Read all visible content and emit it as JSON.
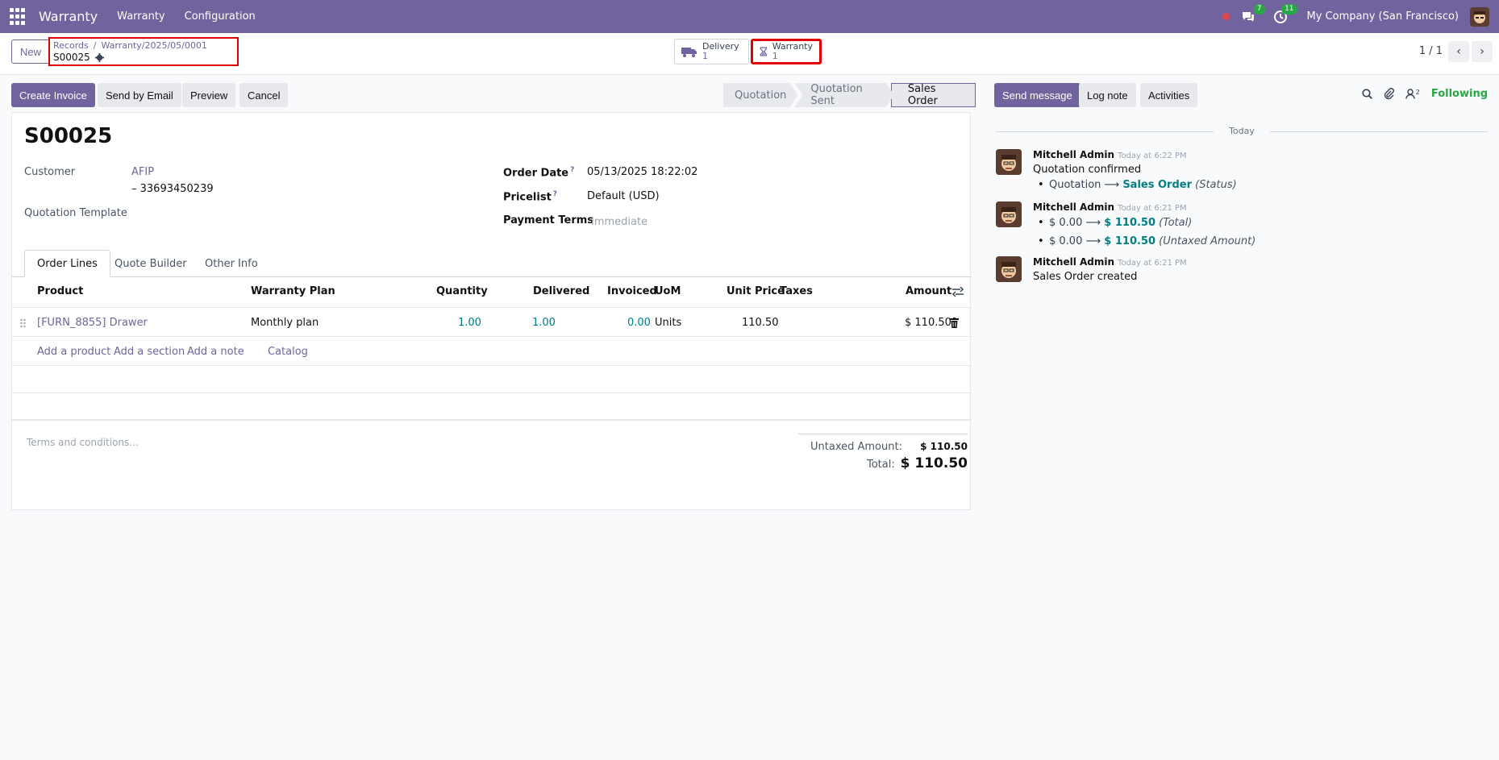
{
  "topbar": {
    "app_name": "Warranty",
    "menu": [
      "Warranty",
      "Configuration"
    ],
    "messages_count": "7",
    "activities_count": "11",
    "company": "My Company (San Francisco)"
  },
  "control": {
    "new_label": "New",
    "breadcrumb": [
      "Records",
      "Warranty/2025/05/0001"
    ],
    "current_record": "S00025",
    "smart_buttons": [
      {
        "label": "Delivery",
        "value": "1",
        "icon": "truck-icon"
      },
      {
        "label": "Warranty",
        "value": "1",
        "icon": "hourglass-icon"
      }
    ],
    "pager": "1 / 1"
  },
  "actions": {
    "create_invoice": "Create Invoice",
    "send_by_email": "Send by Email",
    "preview": "Preview",
    "cancel": "Cancel"
  },
  "statusbar": [
    "Quotation",
    "Quotation Sent",
    "Sales Order"
  ],
  "form": {
    "title": "S00025",
    "customer_label": "Customer",
    "customer_value": "AFIP",
    "customer_sub": "– 33693450239",
    "quotation_template_label": "Quotation Template",
    "order_date_label": "Order Date",
    "order_date_value": "05/13/2025 18:22:02",
    "pricelist_label": "Pricelist",
    "pricelist_value": "Default (USD)",
    "payment_terms_label": "Payment Terms",
    "payment_terms_placeholder": "Immediate",
    "help_mark": "?"
  },
  "tabs": [
    "Order Lines",
    "Quote Builder",
    "Other Info"
  ],
  "table": {
    "headers": [
      "Product",
      "Warranty Plan",
      "Quantity",
      "Delivered",
      "Invoiced",
      "UoM",
      "Unit Price",
      "Taxes",
      "Amount"
    ],
    "rows": [
      {
        "product": "[FURN_8855] Drawer",
        "warranty_plan": "Monthly plan",
        "quantity": "1.00",
        "delivered": "1.00",
        "invoiced": "0.00",
        "uom": "Units",
        "unit_price": "110.50",
        "taxes": "",
        "amount": "$ 110.50"
      }
    ],
    "add_links": [
      "Add a product",
      "Add a section",
      "Add a note",
      "Catalog"
    ]
  },
  "terms_placeholder": "Terms and conditions...",
  "totals": {
    "untaxed_label": "Untaxed Amount:",
    "untaxed_value": "$ 110.50",
    "total_label": "Total:",
    "total_value": "$ 110.50"
  },
  "chatter": {
    "send_message": "Send message",
    "log_note": "Log note",
    "activities": "Activities",
    "followers_count": "2",
    "following": "Following",
    "date_separator": "Today",
    "messages": [
      {
        "author": "Mitchell Admin",
        "time": "Today at 6:22 PM",
        "body": "Quotation confirmed",
        "tracking": [
          {
            "old": "Quotation",
            "new": "Sales Order",
            "field": "(Status)"
          }
        ]
      },
      {
        "author": "Mitchell Admin",
        "time": "Today at 6:21 PM",
        "body": "",
        "tracking": [
          {
            "old": "$ 0.00",
            "new": "$ 110.50",
            "field": "(Total)"
          },
          {
            "old": "$ 0.00",
            "new": "$ 110.50",
            "field": "(Untaxed Amount)"
          }
        ]
      },
      {
        "author": "Mitchell Admin",
        "time": "Today at 6:21 PM",
        "body": "Sales Order created",
        "tracking": []
      }
    ]
  },
  "colors": {
    "brand": "#71639e",
    "highlight": "#e00000",
    "value_teal": "#017e84",
    "following_green": "#28a745"
  }
}
